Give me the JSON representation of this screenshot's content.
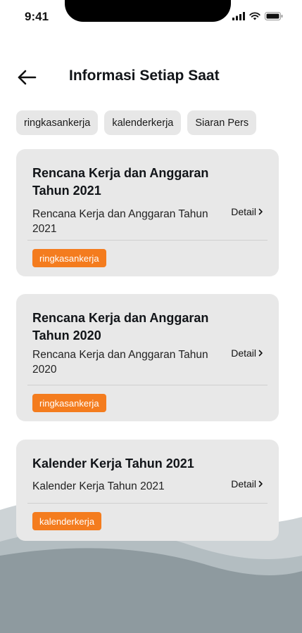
{
  "status_bar": {
    "time": "9:41"
  },
  "header": {
    "title": "Informasi Setiap Saat"
  },
  "filters": [
    "ringkasankerja",
    "kalenderkerja",
    "Siaran Pers"
  ],
  "cards": [
    {
      "title": "Rencana Kerja dan Anggaran Tahun 2021",
      "description": "Rencana Kerja dan Anggaran Tahun 2021",
      "detail_label": "Detail",
      "tag": "ringkasankerja"
    },
    {
      "title": "Rencana Kerja dan Anggaran Tahun 2020",
      "description": "Rencana Kerja dan Anggaran Tahun 2020",
      "detail_label": "Detail",
      "tag": "ringkasankerja"
    },
    {
      "title": "Kalender Kerja Tahun 2021",
      "description": "Kalender Kerja Tahun 2021",
      "detail_label": "Detail",
      "tag": "kalenderkerja"
    }
  ],
  "colors": {
    "tag": "#f47c1e",
    "card_background": "#e8e8e8",
    "chip_background": "#e7e7e7",
    "wave_light": "#cdd3d6",
    "wave_dark": "#8e9a9f"
  },
  "icons": [
    "back-arrow-icon",
    "signal-icon",
    "wifi-icon",
    "battery-icon",
    "chevron-right-icon"
  ]
}
